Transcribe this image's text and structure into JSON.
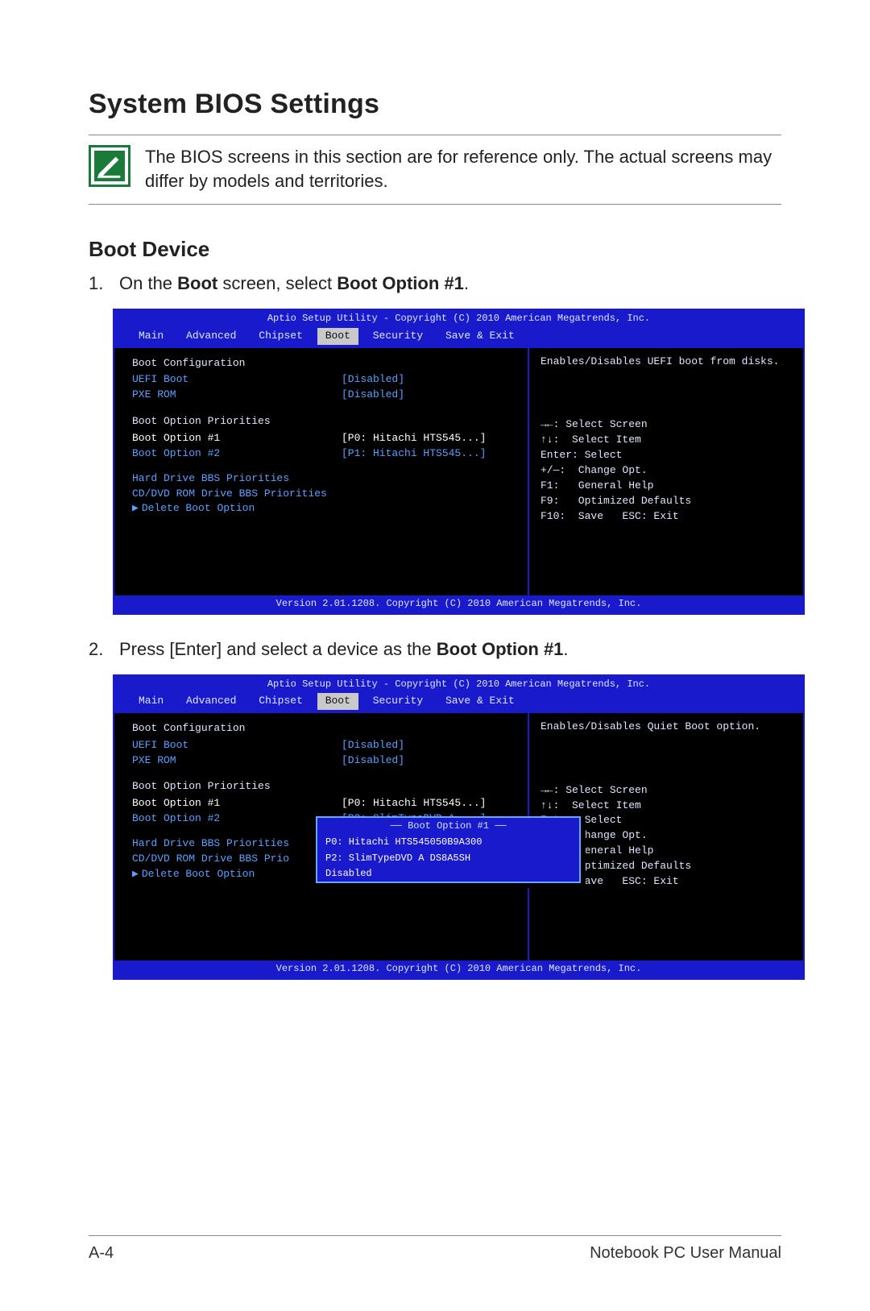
{
  "title": "System BIOS Settings",
  "note": "The BIOS screens in this section are for reference only. The actual screens may differ by models and territories.",
  "section": "Boot Device",
  "step1_prefix": "On the ",
  "step1_bold1": "Boot",
  "step1_mid": " screen, select ",
  "step1_bold2": "Boot Option #1",
  "step1_suffix": ".",
  "step2_prefix": "Press [Enter] and select a device as the ",
  "step2_bold": "Boot Option #1",
  "step2_suffix": ".",
  "bios": {
    "header": "Aptio Setup Utility - Copyright (C) 2010 American Megatrends, Inc.",
    "footer": "Version 2.01.1208. Copyright (C) 2010 American Megatrends, Inc.",
    "menus": [
      "Main",
      "Advanced",
      "Chipset",
      "Boot",
      "Security",
      "Save & Exit"
    ],
    "selected_menu": "Boot",
    "groups": {
      "boot_cfg": "Boot Configuration",
      "uefi": {
        "label": "UEFI Boot",
        "value": "[Disabled]"
      },
      "pxe": {
        "label": "PXE ROM",
        "value": "[Disabled]"
      },
      "prio_hdr": "Boot Option Priorities",
      "opt1": {
        "label": "Boot Option #1",
        "value": "[P0: Hitachi HTS545...]"
      },
      "opt2": {
        "label": "Boot Option #2",
        "value": "[P1: Hitachi HTS545...]"
      },
      "opt2b": {
        "label": "Boot Option #2",
        "value": "[P2: SlimTypeDVD A ...]"
      },
      "hdd": "Hard Drive BBS Priorities",
      "cddvd": "CD/DVD ROM Drive BBS Priorities",
      "cddvd_short": "CD/DVD ROM Drive BBS Prio",
      "del": "Delete Boot Option"
    },
    "desc1": "Enables/Disables UEFI boot from disks.",
    "desc2": "Enables/Disables Quiet Boot option.",
    "help": [
      "→←: Select Screen",
      "↑↓:  Select Item",
      "Enter: Select",
      "+/—:  Change Opt.",
      "F1:   General Help",
      "F9:   Optimized Defaults",
      "F10:  Save   ESC: Exit"
    ],
    "popup": {
      "title": "Boot Option #1",
      "items": [
        "P0: Hitachi HTS545050B9A300",
        "P2: SlimTypeDVD A DS8A5SH",
        "Disabled"
      ]
    }
  },
  "page_left": "A-4",
  "page_right": "Notebook PC User Manual"
}
